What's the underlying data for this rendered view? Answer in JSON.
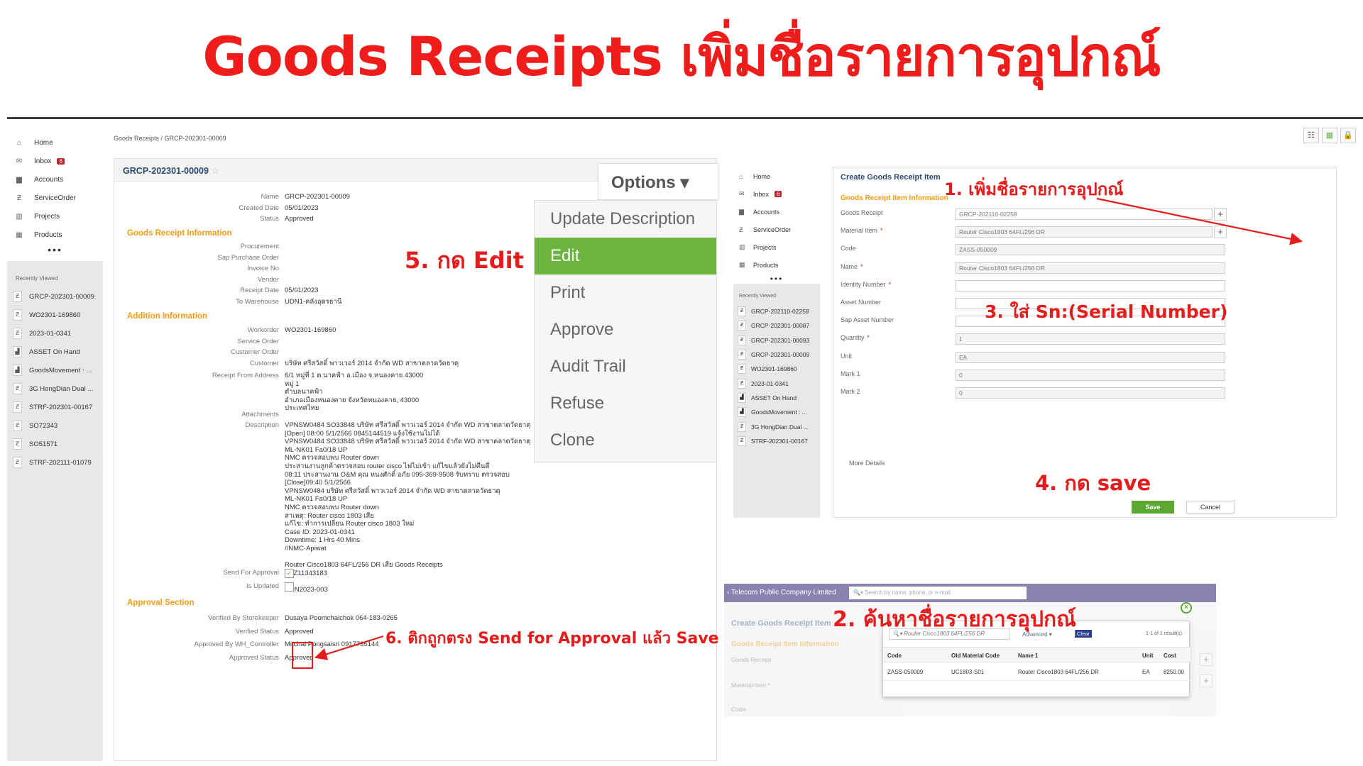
{
  "banner": {
    "title": "Goods Receipts เพิ่มชื่อรายการอุปกณ์"
  },
  "sidebar": {
    "items": [
      {
        "icon": "home-icon",
        "glyph": "⌂",
        "label": "Home"
      },
      {
        "icon": "inbox-icon",
        "glyph": "✉",
        "label": "Inbox",
        "badge": "6"
      },
      {
        "icon": "accounts-icon",
        "glyph": "▆",
        "label": "Accounts"
      },
      {
        "icon": "serviceorder-icon",
        "glyph": "Ƶ",
        "label": "ServiceOrder"
      },
      {
        "icon": "projects-icon",
        "glyph": "▥",
        "label": "Projects"
      },
      {
        "icon": "products-icon",
        "glyph": "▦",
        "label": "Products"
      }
    ],
    "more": "•••",
    "recent_header": "Recently Viewed",
    "recent": [
      {
        "glyph": "Ƶ",
        "label": "GRCP-202301-00009"
      },
      {
        "glyph": "Ƶ",
        "label": "WO2301-169860"
      },
      {
        "glyph": "Ƶ",
        "label": "2023-01-0341"
      },
      {
        "glyph": "▟",
        "label": "ASSET On Hand"
      },
      {
        "glyph": "▟",
        "label": "GoodsMovement : ..."
      },
      {
        "glyph": "Ƶ",
        "label": "3G HongDian Dual ..."
      },
      {
        "glyph": "Ƶ",
        "label": "STRF-202301-00167"
      },
      {
        "glyph": "Ƶ",
        "label": "SO72343"
      },
      {
        "glyph": "Ƶ",
        "label": "SO51571"
      },
      {
        "glyph": "Ƶ",
        "label": "STRF-202111-01079"
      }
    ]
  },
  "breadcrumb": "Goods Receipts / GRCP-202301-00009",
  "record": {
    "title": "GRCP-202301-00009",
    "star": "☆",
    "fields_top": [
      {
        "label": "Name",
        "value": "GRCP-202301-00009"
      },
      {
        "label": "Created Date",
        "value": "05/01/2023"
      },
      {
        "label": "Status",
        "value": "Approved"
      }
    ],
    "section_gr": "Goods Receipt Information",
    "fields_gr": [
      {
        "label": "Procurement",
        "value": ""
      },
      {
        "label": "Sap Purchase Order",
        "value": ""
      },
      {
        "label": "Invoice No",
        "value": ""
      },
      {
        "label": "Vendor",
        "value": ""
      },
      {
        "label": "Receipt Date",
        "value": "05/01/2023"
      },
      {
        "label": "To Warehouse",
        "value": "UDN1-คลังอุดรธานี"
      }
    ],
    "section_add": "Addition Information",
    "fields_add": [
      {
        "label": "Workorder",
        "value": "WO2301-169860"
      },
      {
        "label": "Service Order",
        "value": ""
      },
      {
        "label": "Customer Order",
        "value": ""
      },
      {
        "label": "Customer",
        "value": "บริษัท ศรีสวัสดิ์ พาวเวอร์ 2014 จำกัด WD สาขาตลาดวัดธาตุ"
      }
    ],
    "receipt_from_label": "Receipt From Address",
    "receipt_from": "6/1 หมู่ที่ 1 ต.นาคฟ้า อ.เมือง จ.หนองคาย 43000\nหมู่ 1\nตำบลนาคฟ้า\nอำเภอเมืองหนองคาย จังหวัดหนองคาย, 43000\nประเทศไทย",
    "attachments_label": "Attachments",
    "description_label": "Description",
    "description": "VPNSW0484 SO33848 บริษัท ศรีสวัสดิ์ พาวเวอร์ 2014 จำกัด WD สาขาตลาดวัดธาตุ\n[Open] 08:00 5/1/2566 0845144519 แจ้งใช้งานไม่ได้\nVPNSW0484 SO33848 บริษัท ศรีสวัสดิ์ พาวเวอร์ 2014 จำกัด WD สาขาตลาดวัดธาตุ\nML-NK01 Fa0/18 UP\nNMC ตรวจสอบพบ Router down\nประสานงานลูกค้าตรวจสอบ router cisco ไฟไม่เข้า แก้ไขแล้วยังไม่คืนดี\n08:11 ประสานงาน O&M คุณ หนงศักดิ์ อภัย 095-369-9508 รับทราบ ตรวจสอบ\n[Close]09:40 5/1/2566\nVPNSW0484 บริษัท ศรีสวัสดิ์ พาวเวอร์ 2014 จำกัด WD สาขาตลาดวัดธาตุ\nML-NK01 Fa0/18 UP\nNMC ตรวจสอบพบ Router down\nสาเหตุ: Router cisco 1803 เสีย\nแก้ไข: ทำการเปลี่ยน Router cisco 1803 ใหม่\nCase ID: 2023-01-0341\nDowntime: 1 Hrs 40 Mins\n//NMC-Apiwat\n\nRouter Cisco1803 64FL/256 DR เสีย Goods Receipts\nFCZ11343183\n\nUDN2023-003",
    "send_for_approval_label": "Send For Approval",
    "is_updated_label": "Is Updated",
    "section_approval": "Approval Section",
    "fields_approval": [
      {
        "label": "Verified By Storekeeper",
        "value": "Dusaya Poomchaichok 064-183-0265"
      },
      {
        "label": "Verified Status",
        "value": "Approved"
      },
      {
        "label": "Approved By WH_Controller",
        "value": "Mitchai Pongsaisri 0917735144"
      },
      {
        "label": "Approved Status",
        "value": "Approved"
      }
    ]
  },
  "options": {
    "button": "Options ▾",
    "items": [
      "Update Description",
      "Edit",
      "Print",
      "Approve",
      "Audit Trail",
      "Refuse",
      "Clone"
    ],
    "active": 1
  },
  "annotations": {
    "a1": "1. เพิ่มชื่อรายการอุปกณ์",
    "a2": "2. ค้นหาชื่อรายการอุปกณ์",
    "a3": "3. ใส่ Sn:(Serial Number)",
    "a4": "4. กด save",
    "a5": "5. กด Edit",
    "a6": "6. ติกถูกตรง Send for Approval แล้ว Save"
  },
  "create_form": {
    "title": "Create Goods Receipt Item",
    "section": "Goods Receipt Item Information",
    "fields": [
      {
        "label": "Goods Receipt",
        "required": "",
        "value": "GRCP-202110-02258"
      },
      {
        "label": "Material Item",
        "required": "*",
        "value": "Router Cisco1803 64FL/256 DR"
      },
      {
        "label": "Code",
        "required": "",
        "value": "ZASS-050009"
      },
      {
        "label": "Name",
        "required": "*",
        "value": "Router Cisco1803 64FL/256 DR"
      },
      {
        "label": "Identity Number",
        "required": "*",
        "value": ""
      },
      {
        "label": "Asset Number",
        "required": "",
        "value": ""
      },
      {
        "label": "Sap Asset Number",
        "required": "",
        "value": ""
      },
      {
        "label": "Quantity",
        "required": "*",
        "value": "1"
      },
      {
        "label": "Unit",
        "required": "",
        "value": "EA"
      },
      {
        "label": "Mark 1",
        "required": "",
        "value": "0"
      },
      {
        "label": "Mark 2",
        "required": "",
        "value": "0"
      }
    ],
    "more_details": "More Details",
    "save": "Save",
    "cancel": "Cancel",
    "recent": [
      "GRCP-202110-02258",
      "GRCP-202301-00087",
      "GRCP-202301-00093",
      "GRCP-202301-00009",
      "WO2301-169860",
      "2023-01-0341",
      "ASSET On Hand",
      "GoodsMovement : ...",
      "3G HongDian Dual ...",
      "STRF-202301-00167"
    ]
  },
  "search_popup": {
    "topbar_company": "‹ Telecom Public Company Limited",
    "topbar_placeholder": "Search by name, phone, or e-mail",
    "bg_title": "Create Goods Receipt Item",
    "bg_section": "Goods Receipt Item Information",
    "bg_labels": [
      "Goods Receipt",
      "Material Item *",
      "Code"
    ],
    "search_value": "Router Cisco1803 64FL/256 DR",
    "advanced": "Advanced ▾",
    "clear": "Clear",
    "result_count": "1-1 of 1 result(s).",
    "columns": [
      "Code",
      "Old Material Code",
      "Name 1",
      "Unit",
      "Cost"
    ],
    "row": [
      "ZASS-050009",
      "UC1803-S01",
      "Router Cisco1803 64FL/256 DR",
      "EA",
      "8250.00"
    ]
  }
}
